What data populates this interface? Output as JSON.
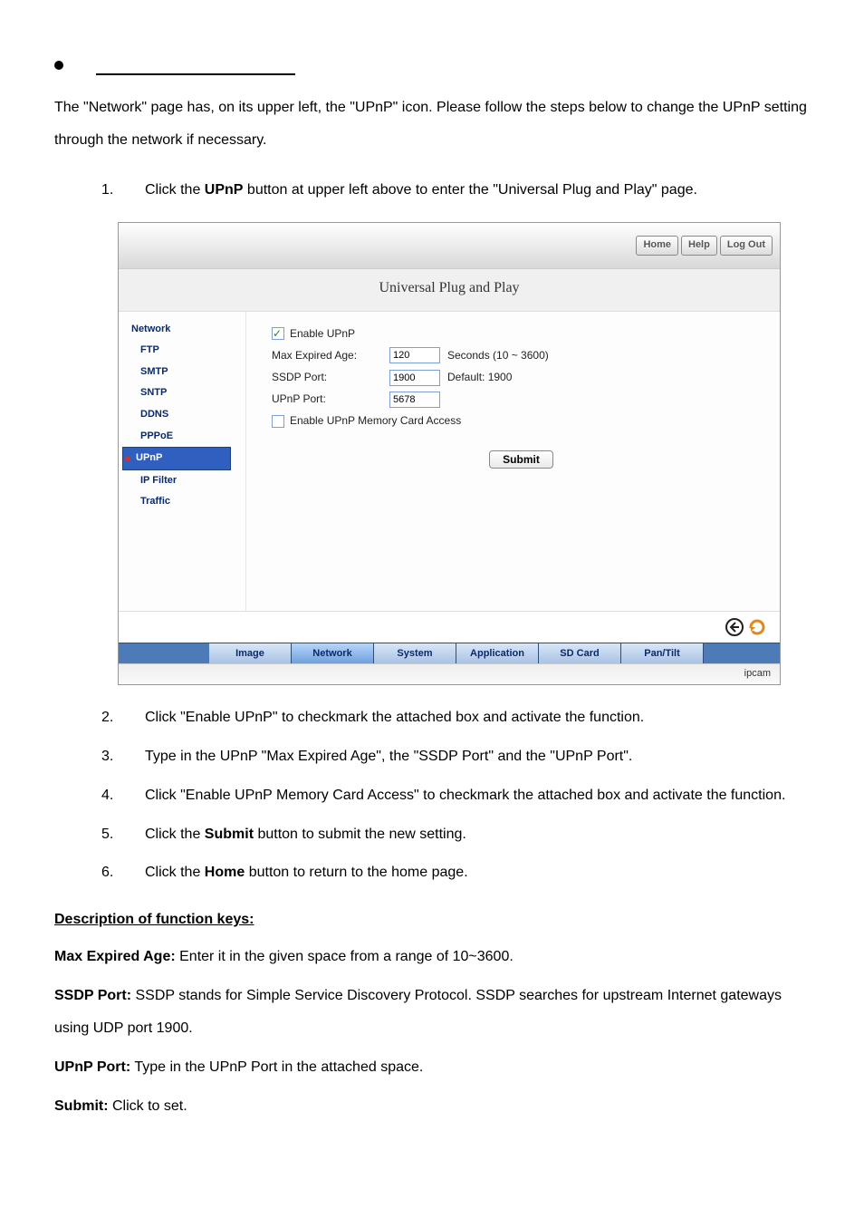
{
  "intro": {
    "text": "The \"Network\" page has, on its upper left, the \"UPnP\" icon. Please follow the steps below to change the UPnP setting through the network if necessary."
  },
  "steps": [
    {
      "n": "1.",
      "pre": "Click the ",
      "bold": "UPnP",
      "post": " button at upper left above to enter the \"Universal Plug and Play\" page."
    },
    {
      "n": "2.",
      "pre": "Click \"Enable UPnP\" to checkmark the attached box and activate the function.",
      "bold": "",
      "post": ""
    },
    {
      "n": "3.",
      "pre": "Type in the UPnP \"Max Expired Age\", the \"SSDP Port\" and the \"UPnP Port\".",
      "bold": "",
      "post": ""
    },
    {
      "n": "4.",
      "pre": "Click \"Enable UPnP Memory Card Access\" to checkmark the attached box and activate the function.",
      "bold": "",
      "post": ""
    },
    {
      "n": "5.",
      "pre": "Click the ",
      "bold": "Submit",
      "post": " button to submit the new setting."
    },
    {
      "n": "6.",
      "pre": "Click the ",
      "bold": "Home",
      "post": " button to return to the home page."
    }
  ],
  "screenshot": {
    "topButtons": [
      "Home",
      "Help",
      "Log Out"
    ],
    "title": "Universal Plug and Play",
    "sidebar": [
      "Network",
      "FTP",
      "SMTP",
      "SNTP",
      "DDNS",
      "PPPoE",
      "UPnP",
      "IP Filter",
      "Traffic"
    ],
    "form": {
      "enable_label": "Enable UPnP",
      "max_label": "Max Expired Age:",
      "max_value": "120",
      "max_hint": "Seconds (10 ~ 3600)",
      "ssdp_label": "SSDP Port:",
      "ssdp_value": "1900",
      "ssdp_hint": "Default: 1900",
      "upnp_label": "UPnP Port:",
      "upnp_value": "5678",
      "mem_label": "Enable UPnP Memory Card Access",
      "submit": "Submit"
    },
    "tabs": [
      "Image",
      "Network",
      "System",
      "Application",
      "SD Card",
      "Pan/Tilt"
    ],
    "brand": "ipcam"
  },
  "desc": {
    "heading": "Description of function keys:",
    "lines": [
      {
        "k": "Max Expired Age:",
        "v": " Enter it in the given space from a range of 10~3600."
      },
      {
        "k": "SSDP Port:",
        "v": " SSDP stands for Simple Service Discovery Protocol. SSDP searches for upstream Internet gateways using UDP port 1900."
      },
      {
        "k": "UPnP Port:",
        "v": " Type in the UPnP Port in the attached space."
      },
      {
        "k": "Submit:",
        "v": " Click to set."
      }
    ]
  }
}
